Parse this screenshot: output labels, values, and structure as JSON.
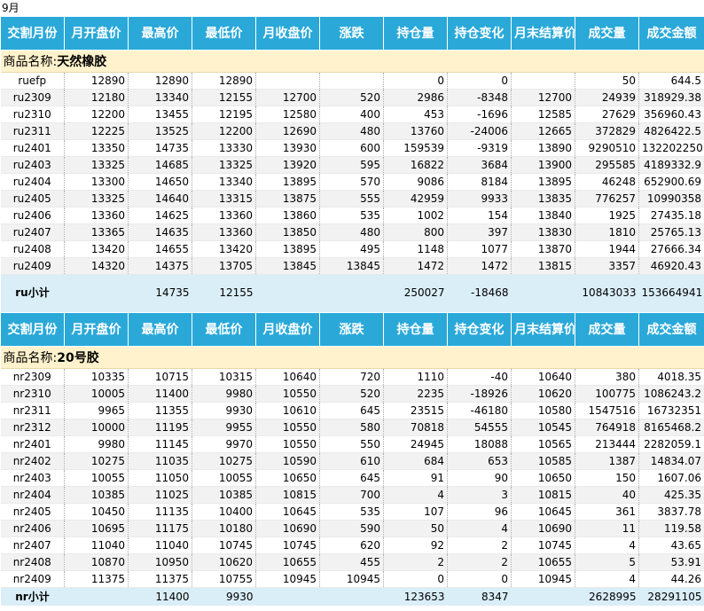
{
  "month": "9月",
  "headers": [
    "交割月份",
    "月开盘价",
    "最高价",
    "最低价",
    "月收盘价",
    "涨跌",
    "持仓量",
    "持仓变化",
    "月末结算价",
    "成交量",
    "成交金额"
  ],
  "sections": [
    {
      "product_label": "商品名称:",
      "product_name": "天然橡胶",
      "rows": [
        [
          "ruefp",
          "12890",
          "12890",
          "12890",
          "",
          "",
          "0",
          "0",
          "",
          "50",
          "644.5"
        ],
        [
          "ru2309",
          "12180",
          "13340",
          "12155",
          "12700",
          "520",
          "2986",
          "-8348",
          "12700",
          "24939",
          "318929.38"
        ],
        [
          "ru2310",
          "12200",
          "13455",
          "12195",
          "12580",
          "400",
          "453",
          "-1696",
          "12585",
          "27629",
          "356960.43"
        ],
        [
          "ru2311",
          "12225",
          "13525",
          "12200",
          "12690",
          "480",
          "13760",
          "-24006",
          "12665",
          "372829",
          "4826422.5"
        ],
        [
          "ru2401",
          "13350",
          "14735",
          "13330",
          "13930",
          "600",
          "159539",
          "-9319",
          "13890",
          "9290510",
          "132202250"
        ],
        [
          "ru2403",
          "13325",
          "14685",
          "13325",
          "13920",
          "595",
          "16822",
          "3684",
          "13900",
          "295585",
          "4189332.9"
        ],
        [
          "ru2404",
          "13300",
          "14650",
          "13340",
          "13895",
          "570",
          "9086",
          "8184",
          "13895",
          "46248",
          "652900.69"
        ],
        [
          "ru2405",
          "13325",
          "14640",
          "13315",
          "13875",
          "555",
          "42959",
          "9933",
          "13835",
          "776257",
          "10990358"
        ],
        [
          "ru2406",
          "13360",
          "14625",
          "13360",
          "13860",
          "535",
          "1002",
          "154",
          "13840",
          "1925",
          "27435.18"
        ],
        [
          "ru2407",
          "13365",
          "14635",
          "13360",
          "13850",
          "480",
          "800",
          "397",
          "13830",
          "1810",
          "25765.13"
        ],
        [
          "ru2408",
          "13420",
          "14655",
          "13420",
          "13895",
          "495",
          "1148",
          "1077",
          "13870",
          "1944",
          "27666.34"
        ],
        [
          "ru2409",
          "14320",
          "14375",
          "13705",
          "13845",
          "13845",
          "1472",
          "1472",
          "13815",
          "3357",
          "46920.43"
        ]
      ],
      "subtotal": [
        "ru小计",
        "",
        "14735",
        "12155",
        "",
        "",
        "250027",
        "-18468",
        "",
        "10843033",
        "153664941"
      ]
    },
    {
      "product_label": "商品名称:",
      "product_name": "20号胶",
      "rows": [
        [
          "nr2309",
          "10335",
          "10715",
          "10315",
          "10640",
          "720",
          "1110",
          "-40",
          "10640",
          "380",
          "4018.35"
        ],
        [
          "nr2310",
          "10005",
          "11400",
          "9980",
          "10550",
          "520",
          "2235",
          "-18926",
          "10620",
          "100775",
          "1086243.2"
        ],
        [
          "nr2311",
          "9965",
          "11355",
          "9930",
          "10610",
          "645",
          "23515",
          "-46180",
          "10580",
          "1547516",
          "16732351"
        ],
        [
          "nr2312",
          "10000",
          "11195",
          "9955",
          "10550",
          "580",
          "70818",
          "54555",
          "10545",
          "764918",
          "8165468.2"
        ],
        [
          "nr2401",
          "9980",
          "11145",
          "9970",
          "10550",
          "550",
          "24945",
          "18088",
          "10565",
          "213444",
          "2282059.1"
        ],
        [
          "nr2402",
          "10275",
          "11035",
          "10275",
          "10590",
          "610",
          "684",
          "653",
          "10585",
          "1387",
          "14834.07"
        ],
        [
          "nr2403",
          "10055",
          "11050",
          "10055",
          "10650",
          "645",
          "91",
          "90",
          "10650",
          "150",
          "1607.06"
        ],
        [
          "nr2404",
          "10385",
          "11025",
          "10385",
          "10815",
          "700",
          "4",
          "3",
          "10815",
          "40",
          "425.35"
        ],
        [
          "nr2405",
          "10450",
          "11135",
          "10400",
          "10645",
          "535",
          "107",
          "96",
          "10645",
          "361",
          "3837.78"
        ],
        [
          "nr2406",
          "10695",
          "11175",
          "10180",
          "10690",
          "590",
          "50",
          "4",
          "10690",
          "11",
          "119.58"
        ],
        [
          "nr2407",
          "11040",
          "11040",
          "10745",
          "10745",
          "620",
          "92",
          "2",
          "10745",
          "4",
          "43.65"
        ],
        [
          "nr2408",
          "10870",
          "10950",
          "10620",
          "10655",
          "455",
          "2",
          "2",
          "10655",
          "5",
          "53.91"
        ],
        [
          "nr2409",
          "11375",
          "11375",
          "10755",
          "10945",
          "10945",
          "0",
          "0",
          "10945",
          "4",
          "44.26"
        ]
      ],
      "subtotal": [
        "nr小计",
        "",
        "11400",
        "9930",
        "",
        "",
        "123653",
        "8347",
        "",
        "2628995",
        "28291105"
      ]
    }
  ],
  "colors": {
    "header_bg": "#2aa9d9",
    "header_text": "#ffffff",
    "product_bg": "#fff2cc",
    "subtotal_bg": "#daeef8",
    "alt_row_bg": "#f2f2f2"
  }
}
